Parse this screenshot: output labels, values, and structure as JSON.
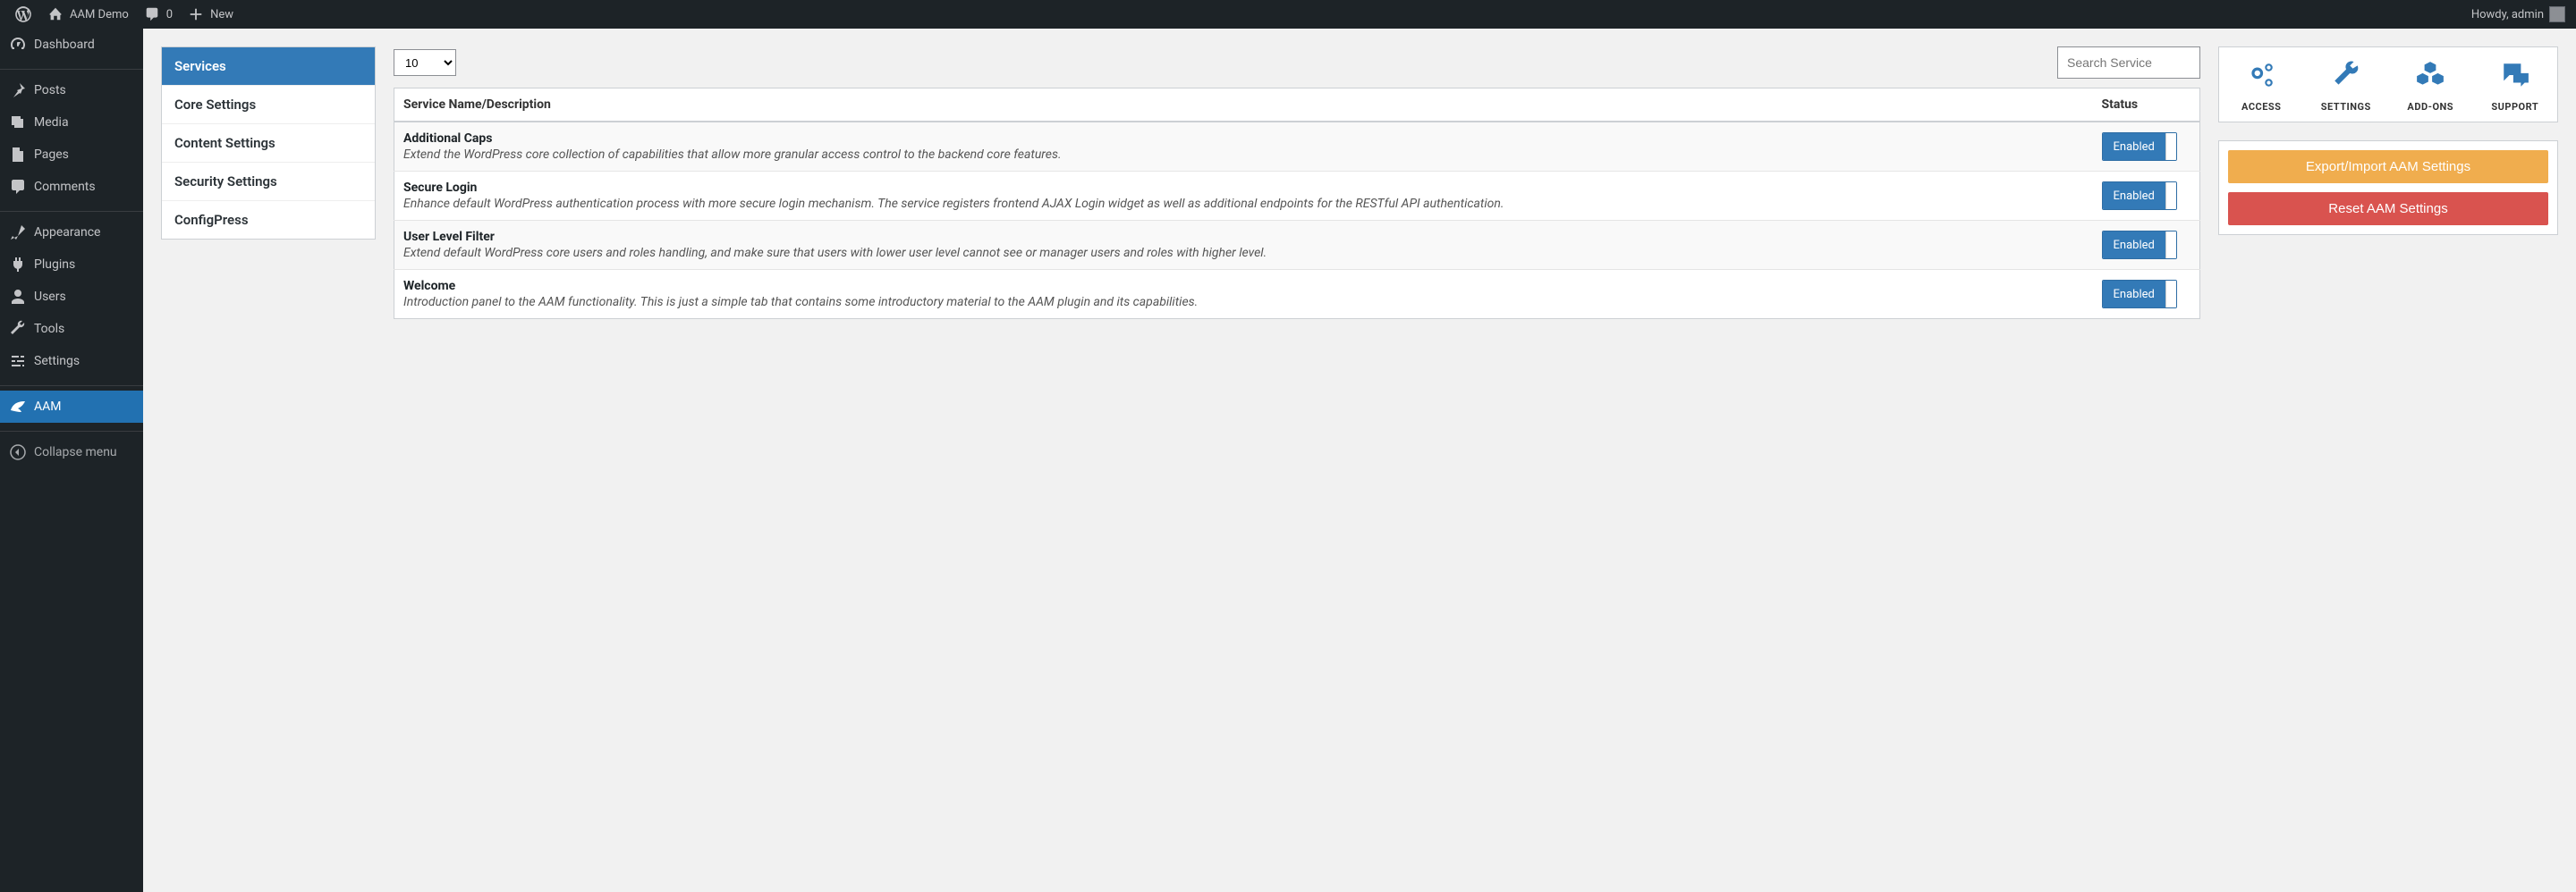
{
  "adminbar": {
    "site_name": "AAM Demo",
    "comments_count": "0",
    "new_label": "New",
    "howdy": "Howdy, admin"
  },
  "sidebar": {
    "items": [
      {
        "label": "Dashboard",
        "icon": "dashboard"
      },
      {
        "label": "Posts",
        "icon": "pin"
      },
      {
        "label": "Media",
        "icon": "media"
      },
      {
        "label": "Pages",
        "icon": "page"
      },
      {
        "label": "Comments",
        "icon": "comment"
      },
      {
        "label": "Appearance",
        "icon": "brush"
      },
      {
        "label": "Plugins",
        "icon": "plug"
      },
      {
        "label": "Users",
        "icon": "user"
      },
      {
        "label": "Tools",
        "icon": "wrench"
      },
      {
        "label": "Settings",
        "icon": "sliders"
      },
      {
        "label": "AAM",
        "icon": "aam"
      }
    ],
    "collapse": "Collapse menu"
  },
  "settings_nav": [
    "Services",
    "Core Settings",
    "Content Settings",
    "Security Settings",
    "ConfigPress"
  ],
  "table": {
    "page_size": "10",
    "search_placeholder": "Search Service",
    "col_name": "Service Name/Description",
    "col_status": "Status",
    "enabled_label": "Enabled",
    "rows": [
      {
        "name": "Additional Caps",
        "desc": "Extend the WordPress core collection of capabilities that allow more granular access control to the backend core features."
      },
      {
        "name": "Secure Login",
        "desc": "Enhance default WordPress authentication process with more secure login mechanism. The service registers frontend AJAX Login widget as well as additional endpoints for the RESTful API authentication."
      },
      {
        "name": "User Level Filter",
        "desc": "Extend default WordPress core users and roles handling, and make sure that users with lower user level cannot see or manager users and roles with higher level."
      },
      {
        "name": "Welcome",
        "desc": "Introduction panel to the AAM functionality. This is just a simple tab that contains some introductory material to the AAM plugin and its capabilities."
      }
    ]
  },
  "icon_tabs": [
    {
      "label": "ACCESS",
      "icon": "cogs"
    },
    {
      "label": "SETTINGS",
      "icon": "wrench"
    },
    {
      "label": "ADD-ONS",
      "icon": "cubes"
    },
    {
      "label": "SUPPORT",
      "icon": "chat"
    }
  ],
  "actions": {
    "export": "Export/Import AAM Settings",
    "reset": "Reset AAM Settings"
  }
}
